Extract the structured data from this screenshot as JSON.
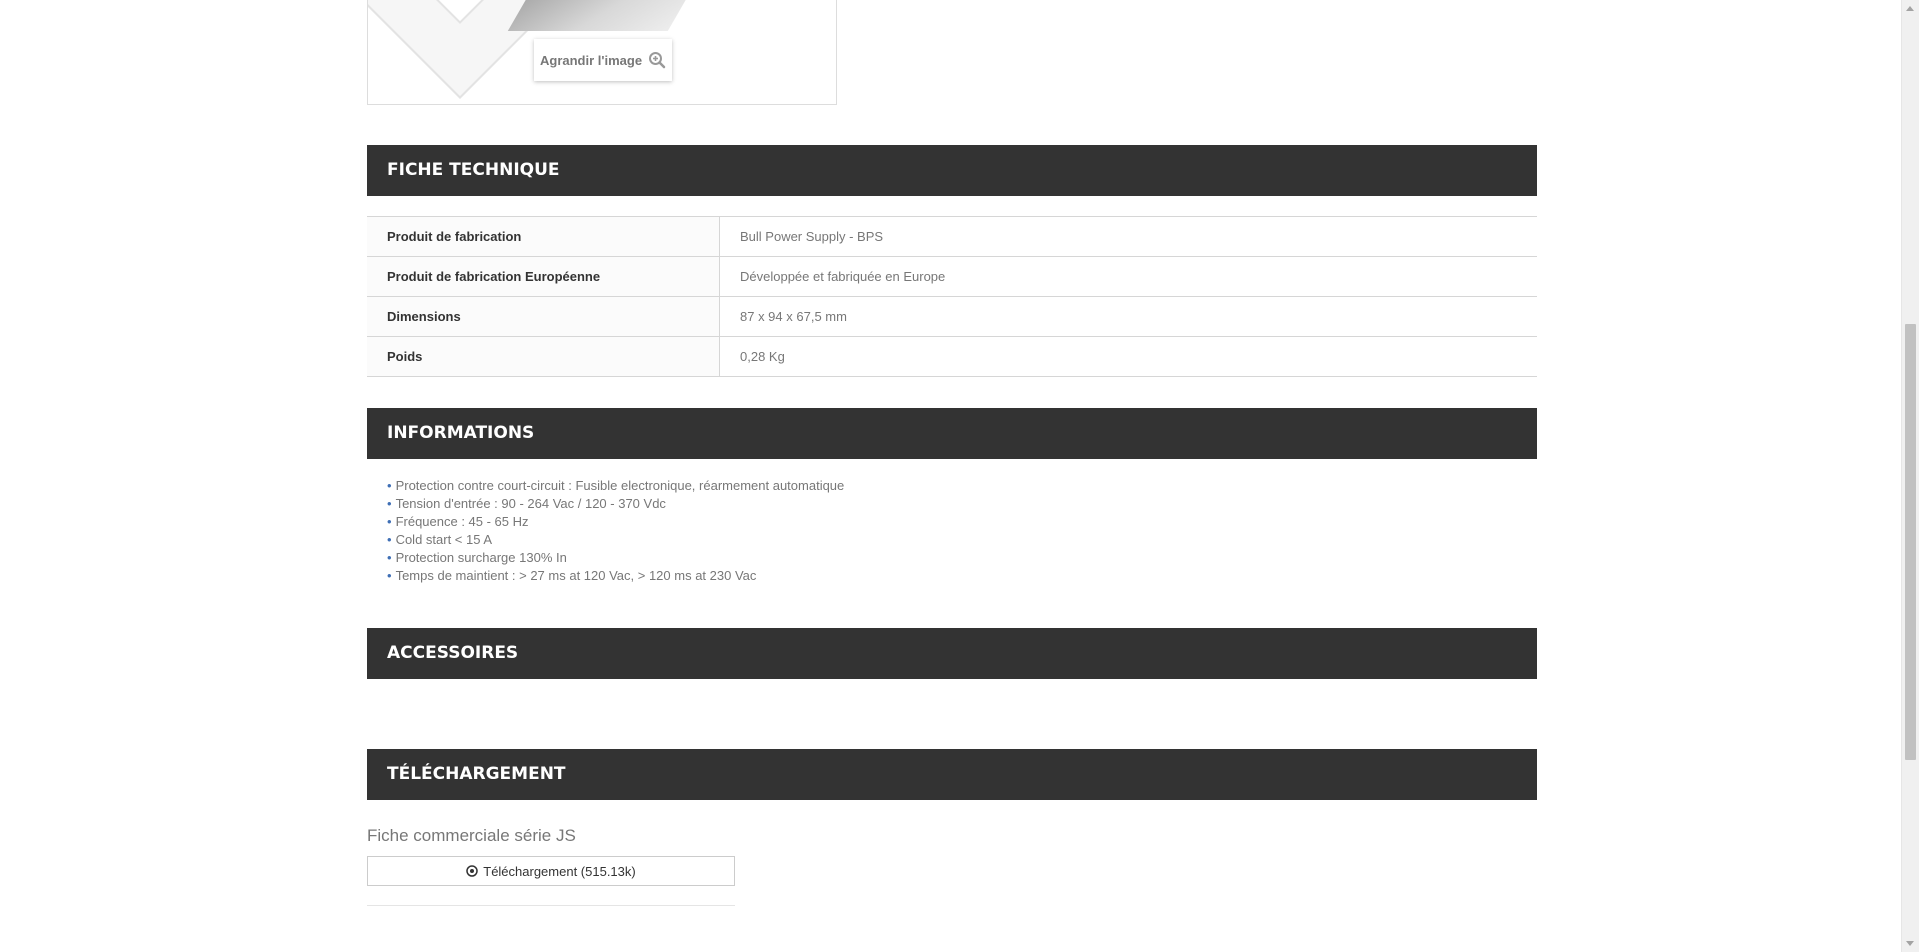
{
  "image_zoom": {
    "label": "Agrandir l'image",
    "icon": "zoom-in-icon"
  },
  "fiche_technique": {
    "title": "FICHE TECHNIQUE",
    "rows": [
      {
        "label": "Produit de fabrication",
        "value": "Bull Power Supply - BPS"
      },
      {
        "label": "Produit de fabrication Européenne",
        "value": "Développée et fabriquée en Europe"
      },
      {
        "label": "Dimensions",
        "value": "87 x 94 x 67,5 mm"
      },
      {
        "label": "Poids",
        "value": "0,28 Kg"
      }
    ]
  },
  "informations": {
    "title": "INFORMATIONS",
    "items": [
      "Protection contre court-circuit : Fusible electronique, réarmement automatique",
      "Tension d'entrée : 90 - 264 Vac / 120 - 370 Vdc",
      "Fréquence : 45 - 65 Hz",
      "Cold start < 15 A",
      "Protection surcharge 130% In",
      "Temps de maintient : > 27 ms at 120 Vac,  > 120 ms at 230 Vac"
    ]
  },
  "accessoires": {
    "title": "ACCESSOIRES"
  },
  "telechargement": {
    "title": "TÉLÉCHARGEMENT",
    "file_title": "Fiche commerciale série JS",
    "button_label": "Téléchargement (515.13k)",
    "button_icon": "download-circle-icon"
  },
  "colors": {
    "header_bg": "#333333",
    "header_text": "#ffffff",
    "bullet": "#3f6fb5",
    "body_text": "#777777"
  }
}
